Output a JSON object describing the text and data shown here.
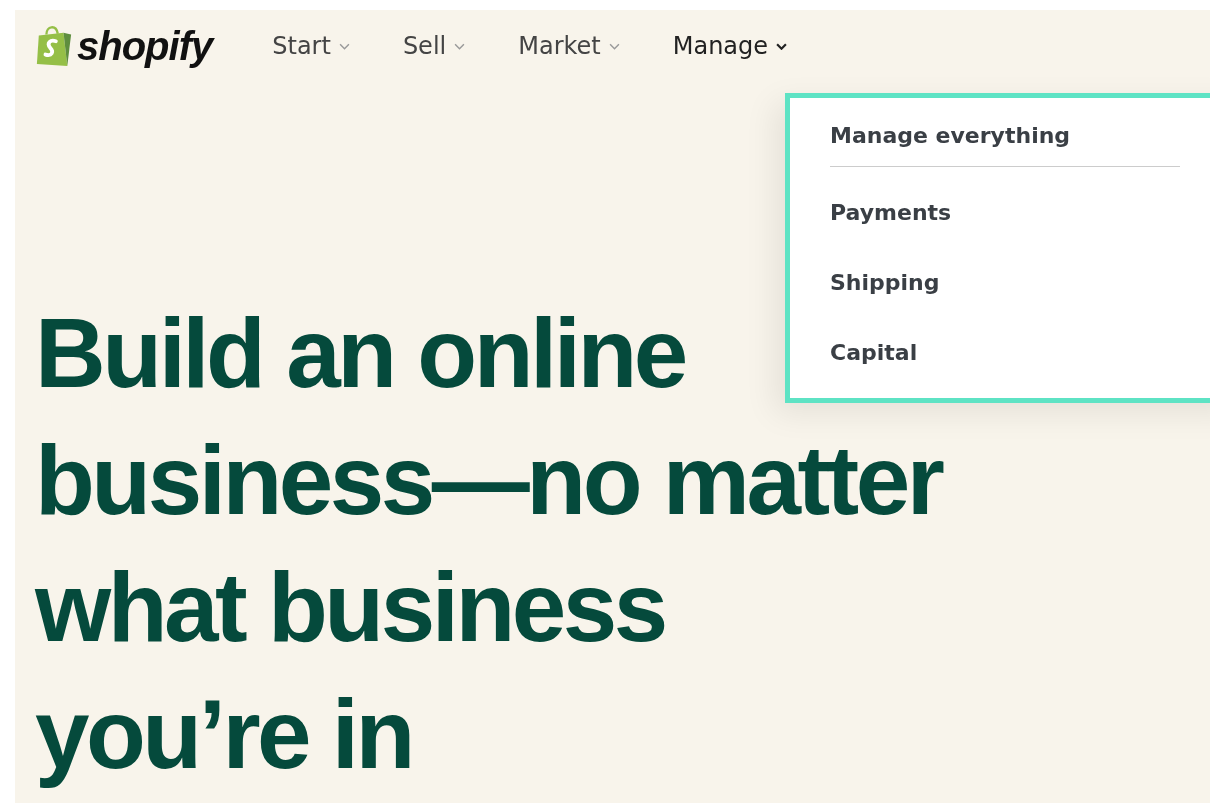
{
  "logo": {
    "text": "shopify"
  },
  "nav": [
    {
      "label": "Start",
      "expanded": false
    },
    {
      "label": "Sell",
      "expanded": false
    },
    {
      "label": "Market",
      "expanded": false
    },
    {
      "label": "Manage",
      "expanded": true
    }
  ],
  "dropdown": {
    "items": [
      {
        "label": "Manage everything",
        "kind": "header"
      },
      {
        "label": "Payments",
        "kind": "link"
      },
      {
        "label": "Shipping",
        "kind": "link"
      },
      {
        "label": "Capital",
        "kind": "link"
      }
    ]
  },
  "hero": {
    "lines": [
      "Build an online",
      "business—no matter",
      "what business",
      "you’re in"
    ]
  }
}
